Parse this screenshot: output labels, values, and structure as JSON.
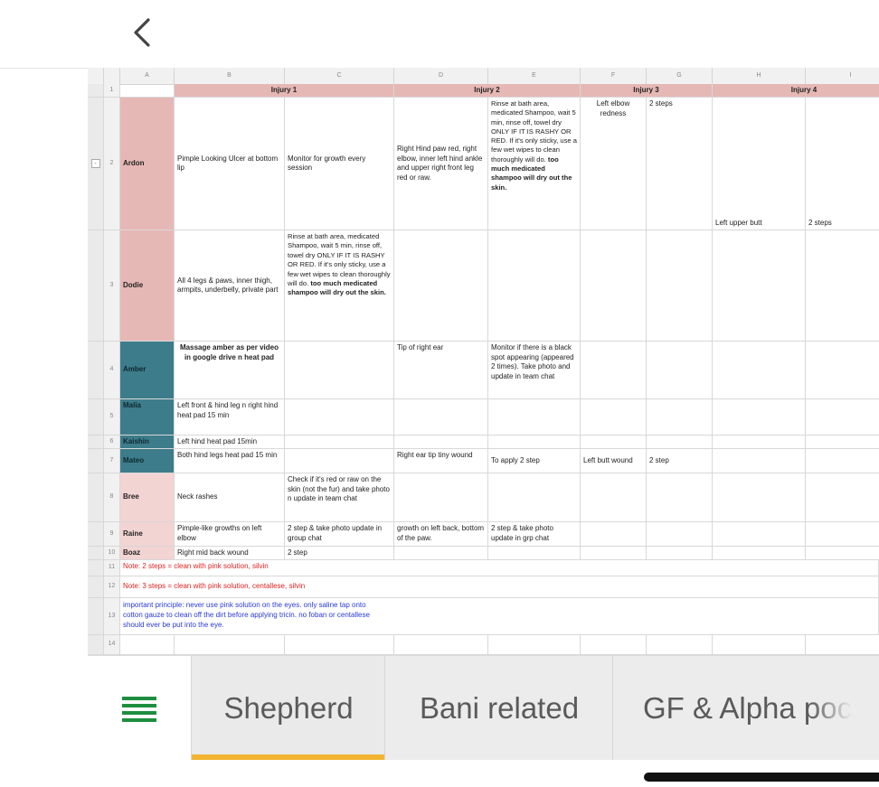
{
  "app": {
    "back_label": "<",
    "icons": {
      "back": "chevron-left-icon",
      "menu": "hamburger-menu-icon",
      "collapse": "collapse-icon"
    }
  },
  "sheet": {
    "columns": [
      "A",
      "B",
      "C",
      "D",
      "E",
      "F",
      "G",
      "H",
      "I"
    ],
    "row_numbers": [
      "1",
      "2",
      "3",
      "4",
      "5",
      "6",
      "7",
      "8",
      "9",
      "10",
      "11",
      "12",
      "13",
      "14"
    ],
    "headers": {
      "injury1": "Injury 1",
      "injury2": "Injury 2",
      "injury3": "Injury 3",
      "injury4": "Injury 4"
    },
    "rows": {
      "ardon": {
        "name": "Ardon",
        "b": "Pimple Looking Ulcer at bottom lip",
        "c": "Monitor for growth every session",
        "d": "Right Hind paw red, right elbow, inner left hind ankle and upper right front leg red or raw.",
        "e_plain": "Rinse at bath area, medicated Shampoo, wait 5 min, rinse off, towel dry ONLY IF IT IS RASHY OR RED. If it's only sticky, use a few wet wipes to clean thoroughly will do.",
        "e_bold": "too much medicated shampoo will dry out the skin.",
        "f": "Left elbow redness",
        "g": "2 steps",
        "h": "Left upper butt",
        "i": "2 steps"
      },
      "dodie": {
        "name": "Dodie",
        "b": "All 4 legs & paws, inner thigh, armpits, underbelly, private part",
        "c_plain": "Rinse at bath area, medicated Shampoo, wait 5 min, rinse off, towel dry ONLY IF IT IS RASHY OR RED. If it's only sticky, use a few wet wipes to clean thoroughly will do.",
        "c_bold": "too much medicated shampoo will dry out the skin."
      },
      "amber": {
        "name": "Amber",
        "b": "Massage amber as per video in google drive n heat pad",
        "d": "Tip of right ear",
        "e": "Monitor if there is a black spot appearing (appeared 2 times). Take photo and update in team chat"
      },
      "malia": {
        "name": "Malia",
        "b": "Left front & hind leg n right hind heat pad 15 min"
      },
      "kaishin": {
        "name": "Kaishin",
        "b": "Left hind heat pad 15min"
      },
      "mateo": {
        "name": "Mateo",
        "b": "Both hind legs heat pad 15 min",
        "d": "Right ear tip tiny wound",
        "e": "To apply 2 step",
        "f": "Left butt wound",
        "g": "2 step"
      },
      "bree": {
        "name": "Bree",
        "b": "Neck rashes",
        "c": "Check if it's red or raw on the skin (not the fur) and take photo n update in team chat"
      },
      "raine": {
        "name": "Raine",
        "b": "Pimple-like growths on left elbow",
        "c": "2 step & take photo update in group chat",
        "d": "growth on left back, bottom of the paw.",
        "e": "2 step & take photo update in grp chat"
      },
      "boaz": {
        "name": "Boaz",
        "b": "Right mid back wound",
        "c": "2 step"
      }
    },
    "notes": {
      "n11": "Note: 2 steps = clean with pink solution, silvin",
      "n12": "Note: 3 steps = clean with pink solution, centallese, silvin",
      "n13": "important principle: never use pink solution on the eyes.  only saline tap onto cotton gauze to clean off the dirt before applying tricin. no foban or centallese should ever be put into the eye."
    }
  },
  "tabs": [
    {
      "label": "Shepherd",
      "active": true
    },
    {
      "label": "Bani related",
      "active": false
    },
    {
      "label": "GF & Alpha poc",
      "active": false
    }
  ],
  "colors": {
    "accent_underline": "#f2b431",
    "menu_icon": "#1e8e3e",
    "name_pink": "#e6b8b5",
    "name_teal": "#3d7c8a"
  }
}
